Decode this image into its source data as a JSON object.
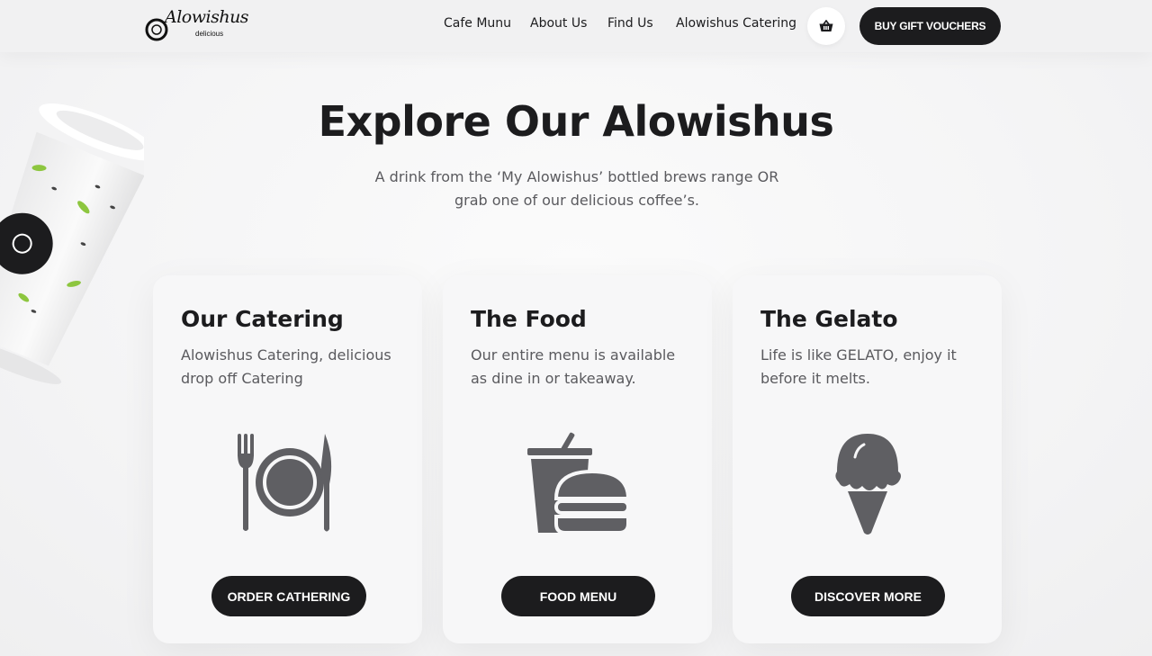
{
  "header": {
    "logo": {
      "brand": "Alowishus",
      "tagline": "delicious"
    },
    "nav": [
      {
        "label": "Cafe Munu"
      },
      {
        "label": "About Us"
      },
      {
        "label": "Find Us"
      },
      {
        "label": "Alowishus Catering"
      }
    ],
    "cart_icon": "basket-icon",
    "gift_button": "BUY GIFT VOUCHERS"
  },
  "hero": {
    "title": "Explore Our Alowishus",
    "subtitle": "A drink from the ‘My Alowishus’ bottled brews range OR grab one of our delicious coffee’s."
  },
  "cards": [
    {
      "title": "Our Catering",
      "text": "Alowishus Catering, delicious drop off Catering",
      "icon": "fork-plate-knife-icon",
      "button": "ORDER CATHERING"
    },
    {
      "title": "The Food",
      "text": "Our entire menu is available as dine in or takeaway.",
      "icon": "drink-burger-icon",
      "button": "FOOD MENU"
    },
    {
      "title": "The Gelato",
      "text": "Life is like GELATO, enjoy it before it melts.",
      "icon": "ice-cream-cone-icon",
      "button": "DISCOVER MORE"
    }
  ],
  "colors": {
    "dark": "#1c1c1e",
    "icon_gray": "#5f5f63",
    "background": "#f4f4f5",
    "card": "#f7f7f8",
    "cup_accent": "#8dc63f"
  }
}
